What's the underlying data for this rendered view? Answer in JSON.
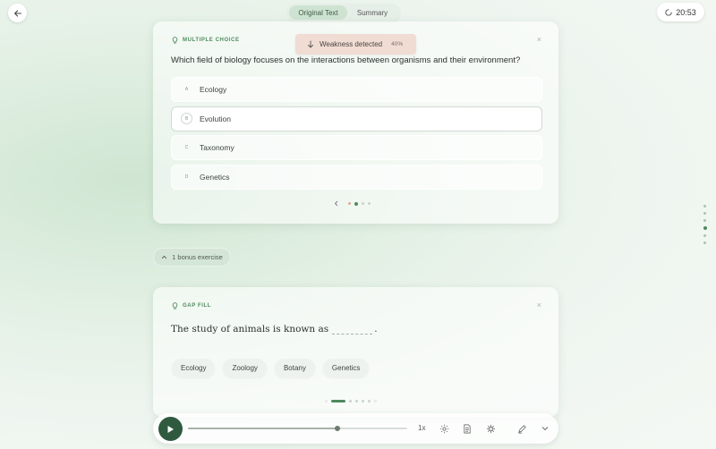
{
  "header": {
    "tabs": [
      {
        "label": "Original Text",
        "active": true
      },
      {
        "label": "Summary",
        "active": false
      }
    ],
    "timer": "20:53"
  },
  "quiz": {
    "type_label": "MULTIPLE CHOICE",
    "question": "Which field of biology focuses on the interactions between organisms and their environment?",
    "options": [
      {
        "letter": "A",
        "text": "Ecology"
      },
      {
        "letter": "B",
        "text": "Evolution",
        "selected": true
      },
      {
        "letter": "C",
        "text": "Taxonomy"
      },
      {
        "letter": "D",
        "text": "Genetics"
      }
    ]
  },
  "weakness": {
    "label": "Weakness detected",
    "percent": "40%"
  },
  "bonus": {
    "label": "1 bonus exercise"
  },
  "gap_fill": {
    "type_label": "GAP FILL",
    "sentence_before": "The study of animals is known as",
    "sentence_after": ".",
    "chips": [
      "Ecology",
      "Zoology",
      "Botany",
      "Genetics"
    ]
  },
  "player": {
    "speed": "1x",
    "progress": 0.68
  },
  "colors": {
    "accent": "#4e8a5d",
    "play": "#2f5a40",
    "weakness_bg": "#f0dcd3"
  }
}
